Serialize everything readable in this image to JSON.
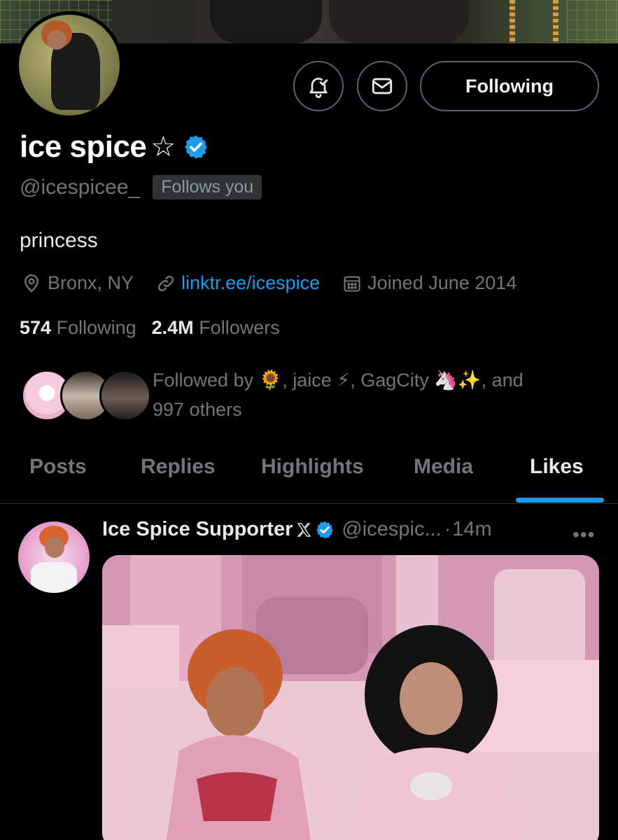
{
  "profile": {
    "display_name": "ice spice",
    "name_symbol": "☆",
    "handle": "@icespicee_",
    "follows_you": "Follows you",
    "bio": "princess",
    "location": "Bronx, NY",
    "link": "linktr.ee/icespice",
    "joined": "Joined June 2014",
    "following_count": "574",
    "following_label": "Following",
    "followers_count": "2.4M",
    "followers_label": "Followers",
    "follow_button": "Following",
    "followed_by": {
      "prefix": "Followed by",
      "name1_emoji": "🌻",
      "name2": ", jaice",
      "name2_emoji": "⚡",
      "name3": ", GagCity",
      "name3_emoji": "🦄✨",
      "suffix": ", and",
      "others": "997 others"
    }
  },
  "icons": {
    "notify": "bell-check-icon",
    "message": "envelope-icon",
    "location": "location-pin-icon",
    "link": "link-icon",
    "calendar": "calendar-icon",
    "verified": "verified-badge-icon",
    "x_logo": "x-logo-icon",
    "more": "more-icon"
  },
  "tabs": [
    {
      "label": "Posts",
      "active": false
    },
    {
      "label": "Replies",
      "active": false
    },
    {
      "label": "Highlights",
      "active": false
    },
    {
      "label": "Media",
      "active": false
    },
    {
      "label": "Likes",
      "active": true
    }
  ],
  "post": {
    "author_name": "Ice Spice Supporter",
    "author_handle": "@icespic...",
    "separator": "·",
    "time": "14m",
    "more": "•••"
  },
  "colors": {
    "background": "#000000",
    "accent": "#1d9bf0",
    "text_primary": "#e7e9ea",
    "text_secondary": "#71767b",
    "border": "#2f3336"
  }
}
